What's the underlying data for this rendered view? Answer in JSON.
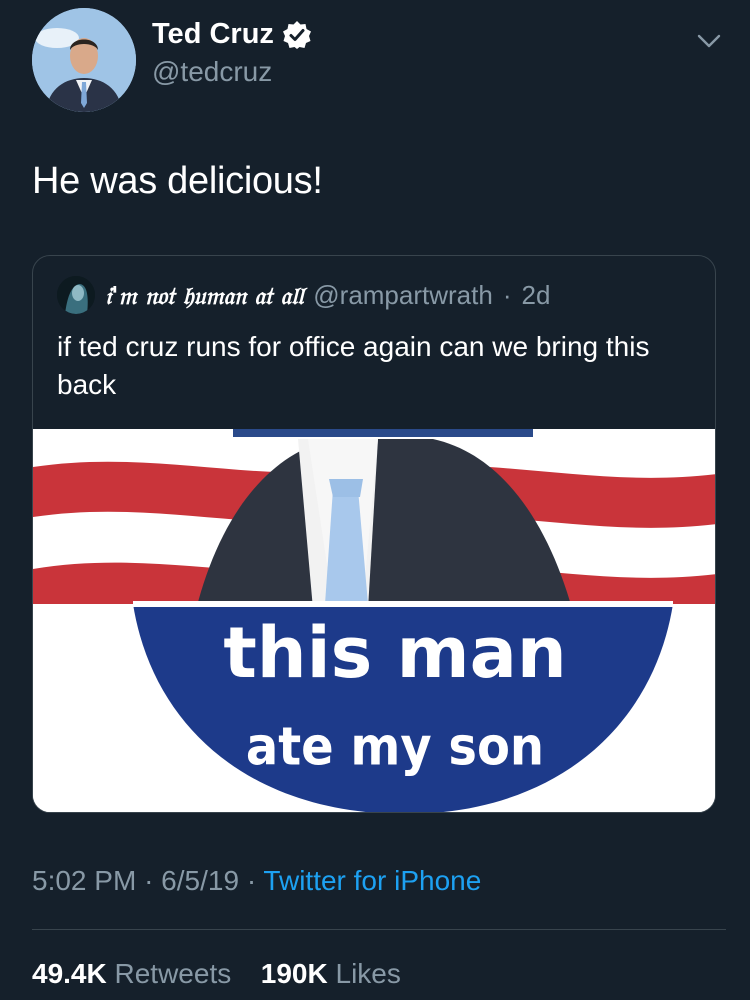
{
  "tweet": {
    "author": {
      "display_name": "Ted Cruz",
      "handle": "@tedcruz",
      "verified_icon": "verified-badge-icon"
    },
    "text": "He was delicious!",
    "quoted": {
      "display_name": "𝔦'𝔪 𝔫𝔬𝔱 𝔥𝔲𝔪𝔞𝔫 𝔞𝔱 𝔞𝔩𝔩",
      "handle": "@rampartwrath",
      "separator": "·",
      "age": "2d",
      "text": "if ted cruz runs for office again can we bring this back",
      "image_text": {
        "line1": "this man",
        "line2": "ate my son"
      }
    },
    "time": "5:02 PM",
    "date": "6/5/19",
    "dot": "·",
    "source": "Twitter for iPhone",
    "retweets_count": "49.4K",
    "retweets_label": "Retweets",
    "likes_count": "190K",
    "likes_label": "Likes"
  },
  "colors": {
    "background": "#15202b",
    "secondary_text": "#8899a6",
    "link": "#1da1f2",
    "border": "#38444d"
  }
}
